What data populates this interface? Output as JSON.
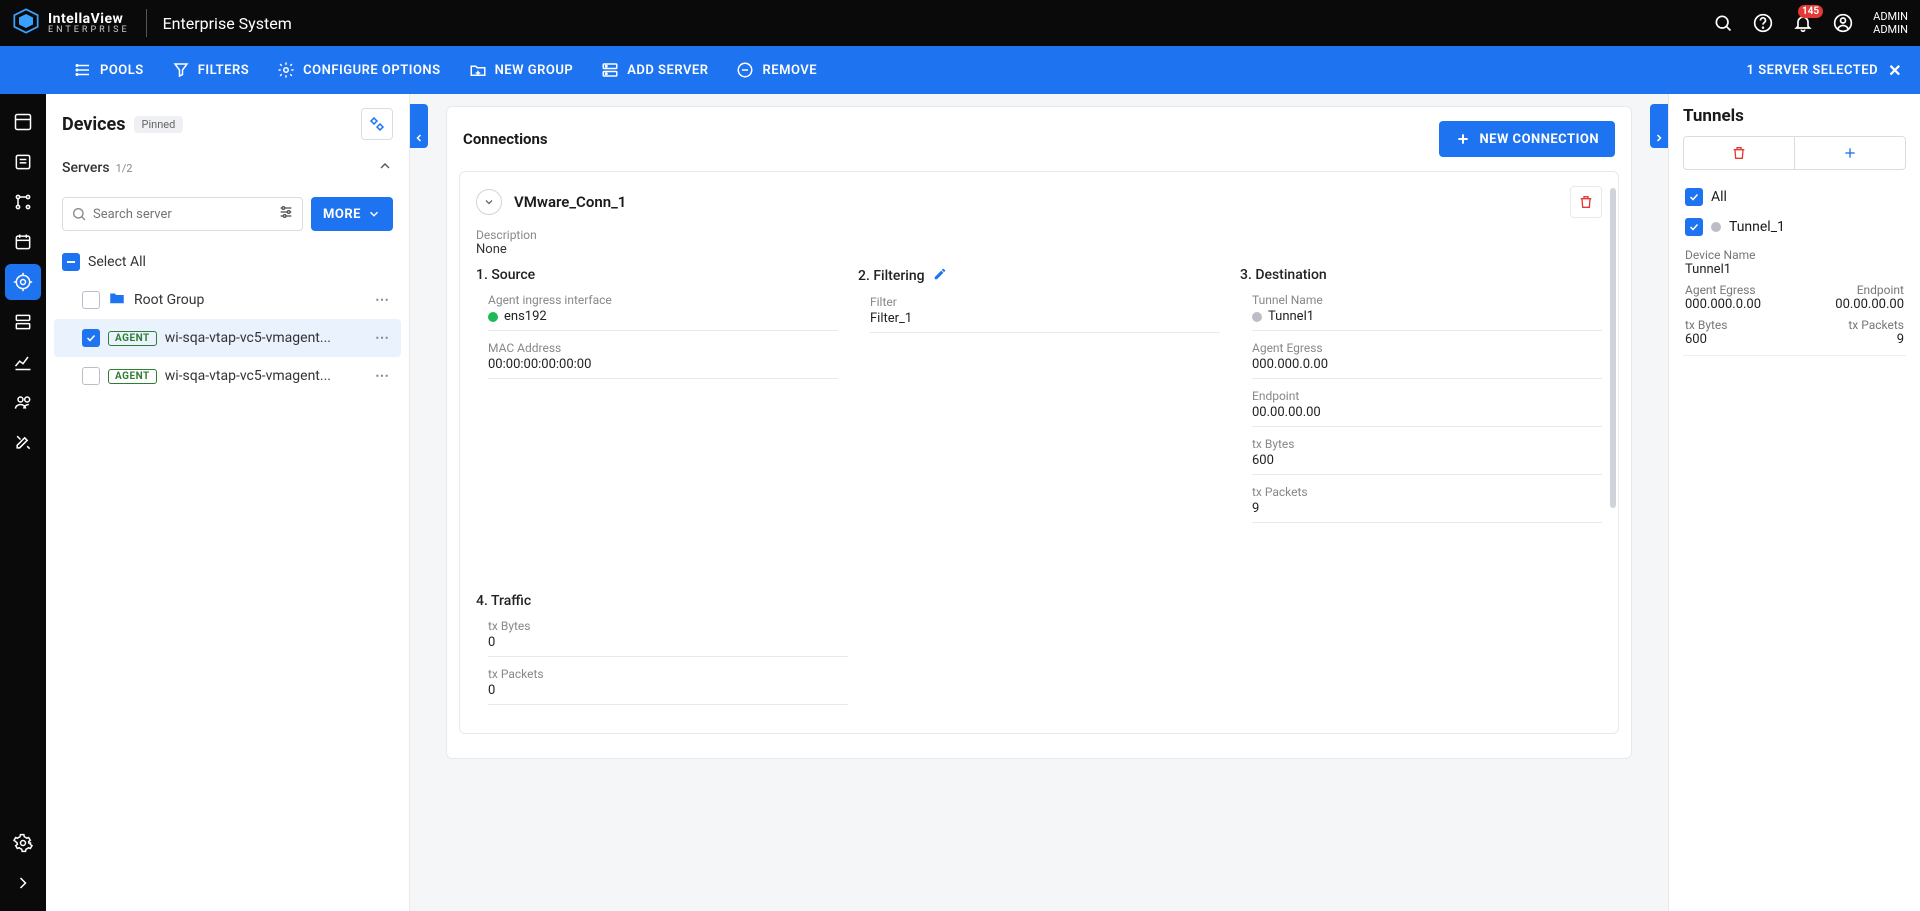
{
  "header": {
    "brand_top": "IntellaView",
    "brand_sub": "ENTERPRISE",
    "system": "Enterprise System",
    "notification_count": "145",
    "user_line1": "ADMIN",
    "user_line2": "ADMIN"
  },
  "bluebar": {
    "pools": "POOLS",
    "filters": "FILTERS",
    "configure": "CONFIGURE OPTIONS",
    "new_group": "NEW GROUP",
    "add_server": "ADD SERVER",
    "remove": "REMOVE",
    "status": "1 SERVER SELECTED"
  },
  "devices": {
    "title": "Devices",
    "pinned": "Pinned",
    "servers_label": "Servers",
    "servers_count": "1/2",
    "search_placeholder": "Search server",
    "more": "MORE",
    "select_all": "Select All",
    "root_group": "Root Group",
    "agent_chip": "AGENT",
    "server1": "wi-sqa-vtap-vc5-vmagent...",
    "server2": "wi-sqa-vtap-vc5-vmagent..."
  },
  "connections": {
    "title": "Connections",
    "new_btn": "NEW CONNECTION",
    "name": "VMware_Conn_1",
    "desc_label": "Description",
    "desc_value": "None",
    "source_title": "1. Source",
    "filtering_title": "2. Filtering",
    "destination_title": "3. Destination",
    "traffic_title": "4. Traffic",
    "source": {
      "ingress_label": "Agent ingress interface",
      "ingress_value": "ens192",
      "mac_label": "MAC Address",
      "mac_value": "00:00:00:00:00:00"
    },
    "filtering": {
      "filter_label": "Filter",
      "filter_value": "Filter_1"
    },
    "destination": {
      "tunnel_label": "Tunnel Name",
      "tunnel_value": "Tunnel1",
      "egress_label": "Agent Egress",
      "egress_value": "000.000.0.00",
      "endpoint_label": "Endpoint",
      "endpoint_value": "00.00.00.00",
      "txbytes_label": "tx Bytes",
      "txbytes_value": "600",
      "txpackets_label": "tx Packets",
      "txpackets_value": "9"
    },
    "traffic": {
      "txbytes_label": "tx Bytes",
      "txbytes_value": "0",
      "txpackets_label": "tx Packets",
      "txpackets_value": "0"
    }
  },
  "tunnels": {
    "title": "Tunnels",
    "all": "All",
    "tunnel_name": "Tunnel_1",
    "device_name_label": "Device Name",
    "device_name_value": "Tunnel1",
    "egress_label": "Agent Egress",
    "egress_value": "000.000.0.00",
    "endpoint_label": "Endpoint",
    "endpoint_value": "00.00.00.00",
    "txbytes_label": "tx Bytes",
    "txbytes_value": "600",
    "txpackets_label": "tx Packets",
    "txpackets_value": "9"
  }
}
